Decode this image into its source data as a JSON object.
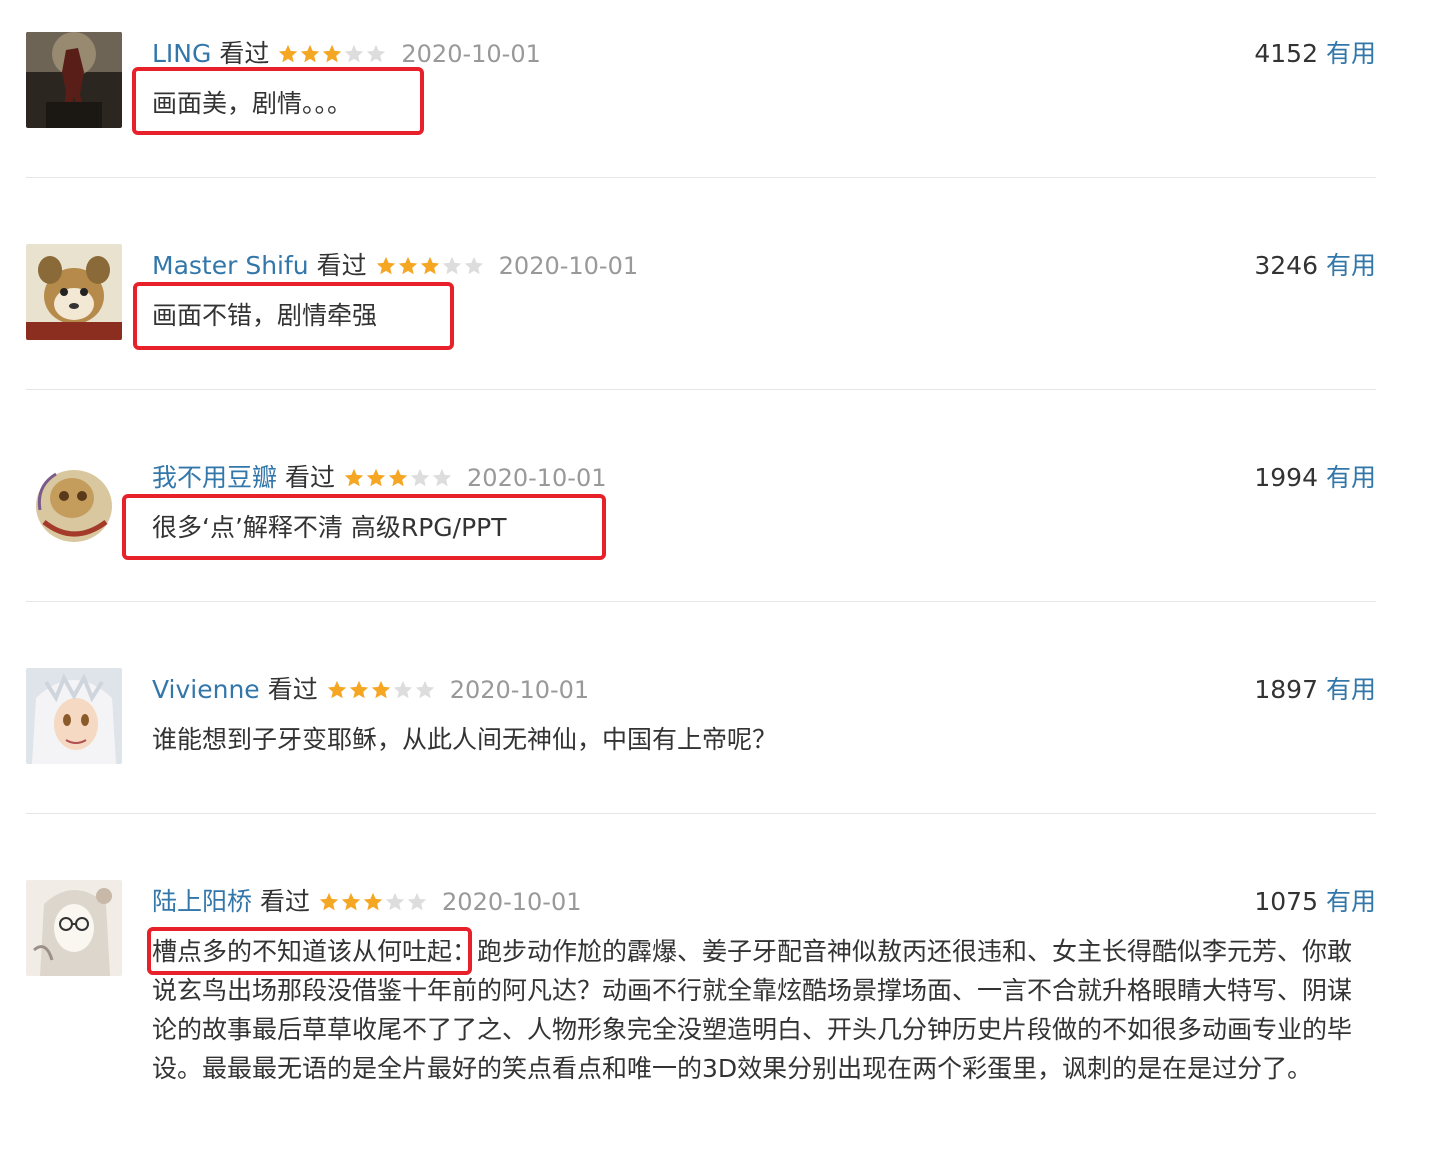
{
  "colors": {
    "username": "#3377aa",
    "useful": "#3377aa",
    "text": "#333333",
    "date": "#999999",
    "star_on": "#f5a623",
    "star_off": "#dddddd",
    "highlight": "#e8202a"
  },
  "reviews": [
    {
      "user": "LING",
      "status": "看过",
      "rating": 3,
      "date": "2020-10-01",
      "votes": "4152",
      "useful_label": "有用",
      "comment": "画面美，剧情。。。",
      "avatar_icon": "poster-figure-avatar"
    },
    {
      "user": "Master Shifu",
      "status": "看过",
      "rating": 3,
      "date": "2020-10-01",
      "votes": "3246",
      "useful_label": "有用",
      "comment": "画面不错，剧情牵强",
      "avatar_icon": "red-panda-avatar"
    },
    {
      "user": "我不用豆瓣",
      "status": "看过",
      "rating": 3,
      "date": "2020-10-01",
      "votes": "1994",
      "useful_label": "有用",
      "comment": "很多‘点’解释不清 高级RPG/PPT",
      "avatar_icon": "skull-ornament-avatar"
    },
    {
      "user": "Vivienne",
      "status": "看过",
      "rating": 3,
      "date": "2020-10-01",
      "votes": "1897",
      "useful_label": "有用",
      "comment": "谁能想到子牙变耶稣，从此人间无神仙，中国有上帝呢？",
      "avatar_icon": "anime-character-avatar"
    },
    {
      "user": "陆上阳桥",
      "status": "看过",
      "rating": 3,
      "date": "2020-10-01",
      "votes": "1075",
      "useful_label": "有用",
      "comment": "槽点多的不知道该从何吐起：跑步动作尬的霹爆、姜子牙配音神似敖丙还很违和、女主长得酷似李元芳、你敢说玄鸟出场那段没借鉴十年前的阿凡达？动画不行就全靠炫酷场景撑场面、一言不合就升格眼睛大特写、阴谋论的故事最后草草收尾不了了之、人物形象完全没塑造明白、开头几分钟历史片段做的不如很多动画专业的毕设。最最最无语的是全片最好的笑点看点和唯一的3D效果分别出现在两个彩蛋里，讽刺的是在是过分了。",
      "avatar_icon": "sketch-girl-avatar"
    }
  ]
}
